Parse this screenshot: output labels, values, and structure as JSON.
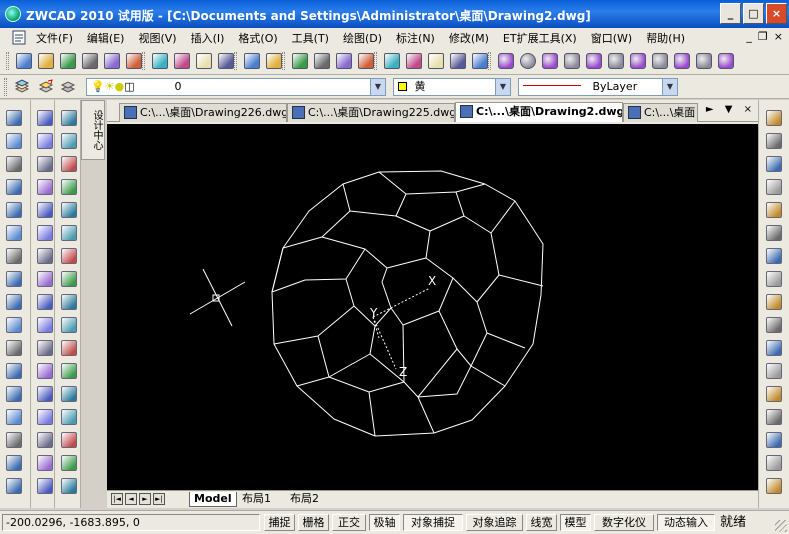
{
  "window": {
    "title": "ZWCAD 2010 试用版 - [C:\\Documents and Settings\\Administrator\\桌面\\Drawing2.dwg]",
    "minimize": "_",
    "maximize": "□",
    "close": "×"
  },
  "menu": {
    "items": [
      "文件(F)",
      "编辑(E)",
      "视图(V)",
      "插入(I)",
      "格式(O)",
      "工具(T)",
      "绘图(D)",
      "标注(N)",
      "修改(M)",
      "ET扩展工具(X)",
      "窗口(W)",
      "帮助(H)"
    ],
    "mdi_min": "_",
    "mdi_restore": "❐",
    "mdi_close": "×"
  },
  "layer_toolbar": {
    "layer_value": "0",
    "color_value": "黄",
    "color_swatch": "#ffff00",
    "linetype_value": "ByLayer"
  },
  "side_panel": {
    "label": "设计中心"
  },
  "tabs": [
    {
      "label": "C:\\...\\桌面\\Drawing226.dwg",
      "active": false
    },
    {
      "label": "C:\\...\\桌面\\Drawing225.dwg",
      "active": false
    },
    {
      "label": "C:\\...\\桌面\\Drawing2.dwg",
      "active": true
    },
    {
      "label": "C:\\...\\桌面",
      "active": false
    }
  ],
  "tab_nav": "◄ ► ▼ ×",
  "viewport": {
    "axis_x": "X",
    "axis_y": "Y",
    "axis_z": "Z",
    "line_color": "#ffffff",
    "background": "#000000"
  },
  "layout_tabs": [
    "Model",
    "布局1",
    "布局2"
  ],
  "layout_nav": [
    "|◄",
    "◄",
    "►",
    "►|"
  ],
  "status": {
    "coords": "-200.0296,  -1683.895,  0",
    "toggles": [
      {
        "label": "捕捉",
        "on": false
      },
      {
        "label": "栅格",
        "on": false
      },
      {
        "label": "正交",
        "on": false
      },
      {
        "label": "极轴",
        "on": true
      },
      {
        "label": "对象捕捉",
        "on": true
      },
      {
        "label": "对象追踪",
        "on": false
      },
      {
        "label": "线宽",
        "on": false
      },
      {
        "label": "模型",
        "on": true
      },
      {
        "label": "数字化仪",
        "on": false
      },
      {
        "label": "动态输入",
        "on": true
      }
    ],
    "ready": "就绪"
  },
  "icons": {
    "toolbar1": [
      "new-icon",
      "open-icon",
      "save-icon",
      "print-icon",
      "print-preview-icon",
      "publish-icon",
      "cut-icon",
      "copy-icon",
      "paste-icon",
      "match-properties-icon",
      "undo-icon",
      "redo-icon",
      "pan-icon",
      "zoom-realtime-icon",
      "zoom-window-icon",
      "zoom-previous-icon",
      "properties-icon",
      "design-center-icon",
      "tool-palette-icon",
      "calculator-icon",
      "help-icon",
      "box-icon",
      "sphere-icon",
      "cylinder-icon",
      "cone-icon",
      "torus-icon",
      "extrude-icon",
      "revolve-icon",
      "union-icon",
      "subtract-icon",
      "intersect-icon",
      "slice-icon"
    ]
  }
}
